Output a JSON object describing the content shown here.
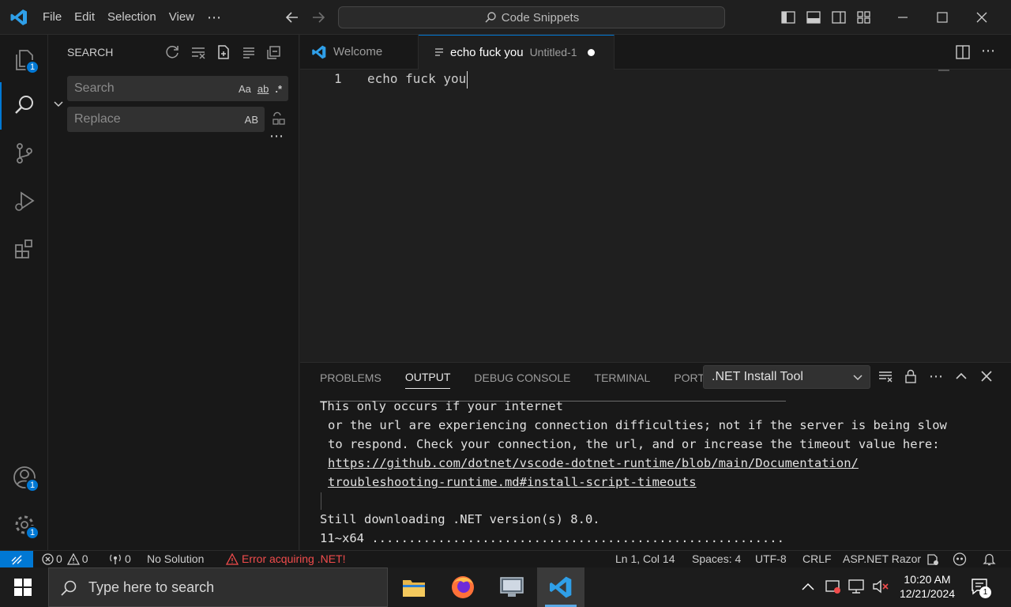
{
  "titlebar": {
    "menus": [
      "File",
      "Edit",
      "Selection",
      "View"
    ],
    "more": "⋯",
    "command_center": "Code Snippets"
  },
  "activity": {
    "explorer_badge": "1",
    "accounts_badge": "1",
    "manage_badge": "1"
  },
  "sidebar": {
    "title": "SEARCH",
    "search_placeholder": "Search",
    "replace_placeholder": "Replace",
    "opt_case": "Aa",
    "opt_word": "ab",
    "opt_regex": ".*",
    "opt_preserve": "AB",
    "more": "⋯"
  },
  "tabs": [
    {
      "label": "Welcome"
    },
    {
      "label": "echo fuck you",
      "desc": "Untitled-1",
      "modified": true
    }
  ],
  "editor": {
    "lines": [
      {
        "num": "1",
        "text": "echo fuck you"
      }
    ]
  },
  "panel": {
    "tabs": [
      "PROBLEMS",
      "OUTPUT",
      "DEBUG CONSOLE",
      "TERMINAL",
      "PORTS"
    ],
    "active_tab": "OUTPUT",
    "output_channel": ".NET Install Tool",
    "output": {
      "l1": "This only occurs if your internet",
      "l2": "or the url are experiencing connection difficulties; not if the server is being slow",
      "l3": "to respond. Check your connection, the url, and or increase the timeout value here:",
      "l4": "https://github.com/dotnet/vscode-dotnet-runtime/blob/main/Documentation/",
      "l5": "troubleshooting-runtime.md#install-script-timeouts",
      "l6": "Still downloading .NET version(s) 8.0.",
      "l7": "11~x64 ........................................................"
    }
  },
  "statusbar": {
    "errors": "0",
    "warnings": "0",
    "ports": "0",
    "solution": "No Solution",
    "error_msg": "Error acquiring .NET!",
    "position": "Ln 1, Col 14",
    "spaces": "Spaces: 4",
    "encoding": "UTF-8",
    "eol": "CRLF",
    "language": "ASP.NET Razor"
  },
  "taskbar": {
    "search_placeholder": "Type here to search",
    "time": "10:20 AM",
    "date": "12/21/2024",
    "notif_count": "1"
  },
  "colors": {
    "accent": "#0078d4",
    "error": "#f14c4c"
  }
}
